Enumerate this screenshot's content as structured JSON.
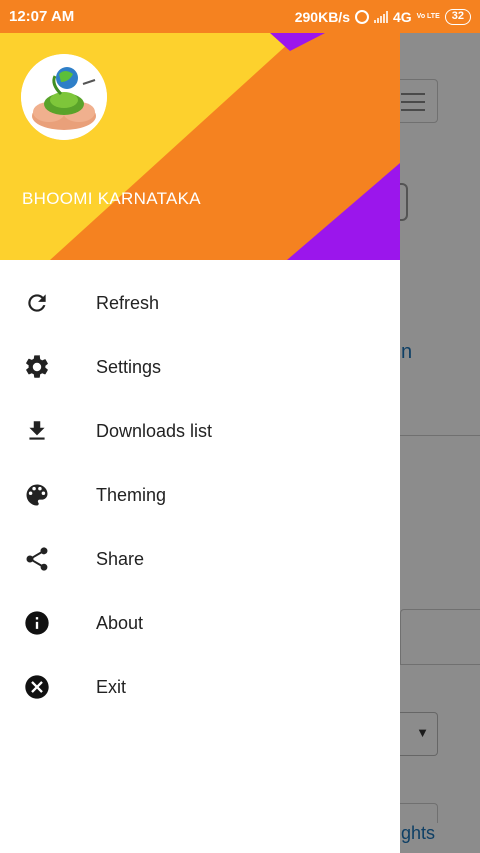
{
  "status_bar": {
    "time": "12:07 AM",
    "speed": "290KB/s",
    "network": "4G",
    "volte": "Vo LTE",
    "battery": "32",
    "color": "#f58220"
  },
  "background_app": {
    "link_fragment": "n",
    "footer_fragment": "ghts",
    "select_arrow": "▼"
  },
  "drawer": {
    "header": {
      "title": "BHOOMI KARNATAKA",
      "colors": {
        "yellow": "#fdd12d",
        "orange": "#f58220",
        "purple": "#9b16ec"
      }
    },
    "items": [
      {
        "label": "Refresh",
        "icon": "refresh-icon"
      },
      {
        "label": "Settings",
        "icon": "gear-icon"
      },
      {
        "label": "Downloads list",
        "icon": "download-icon"
      },
      {
        "label": "Theming",
        "icon": "palette-icon"
      },
      {
        "label": "Share",
        "icon": "share-icon"
      },
      {
        "label": "About",
        "icon": "info-icon"
      },
      {
        "label": "Exit",
        "icon": "close-circle-icon"
      }
    ]
  }
}
